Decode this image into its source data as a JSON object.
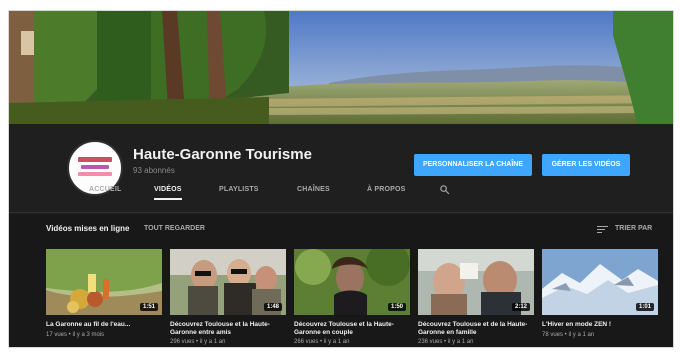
{
  "channel": {
    "name": "Haute-Garonne Tourisme",
    "subscribers": "93 abonnés"
  },
  "buttons": {
    "customize": "PERSONNALISER LA CHAÎNE",
    "manage": "GÉRER LES VIDÉOS"
  },
  "tabs": [
    {
      "label": "ACCUEIL",
      "active": false
    },
    {
      "label": "VIDÉOS",
      "active": true
    },
    {
      "label": "PLAYLISTS",
      "active": false
    },
    {
      "label": "CHAÎNES",
      "active": false
    },
    {
      "label": "À PROPOS",
      "active": false
    }
  ],
  "section": {
    "title": "Vidéos mises en ligne",
    "play_all": "TOUT REGARDER",
    "sort_label": "TRIER PAR"
  },
  "icons": {
    "search": "search-icon",
    "sort": "sort-icon"
  },
  "colors": {
    "accent": "#3ea6ff",
    "background": "#181818",
    "header_background": "#1f1f1f"
  },
  "videos": [
    {
      "title": "La Garonne au fil de l'eau...",
      "meta": "17 vues • il y a 3 mois",
      "duration": "1:51"
    },
    {
      "title": "Découvrez Toulouse et la Haute-Garonne entre amis",
      "meta": "296 vues • il y a 1 an",
      "duration": "1:48"
    },
    {
      "title": "Découvrez Toulouse et la Haute-Garonne en couple",
      "meta": "266 vues • il y a 1 an",
      "duration": "1:50"
    },
    {
      "title": "Découvrez Toulouse et de la Haute-Garonne en famille",
      "meta": "236 vues • il y a 1 an",
      "duration": "2:12"
    },
    {
      "title": "L'Hiver en mode ZEN !",
      "meta": "78 vues • il y a 1 an",
      "duration": "1:01"
    }
  ]
}
